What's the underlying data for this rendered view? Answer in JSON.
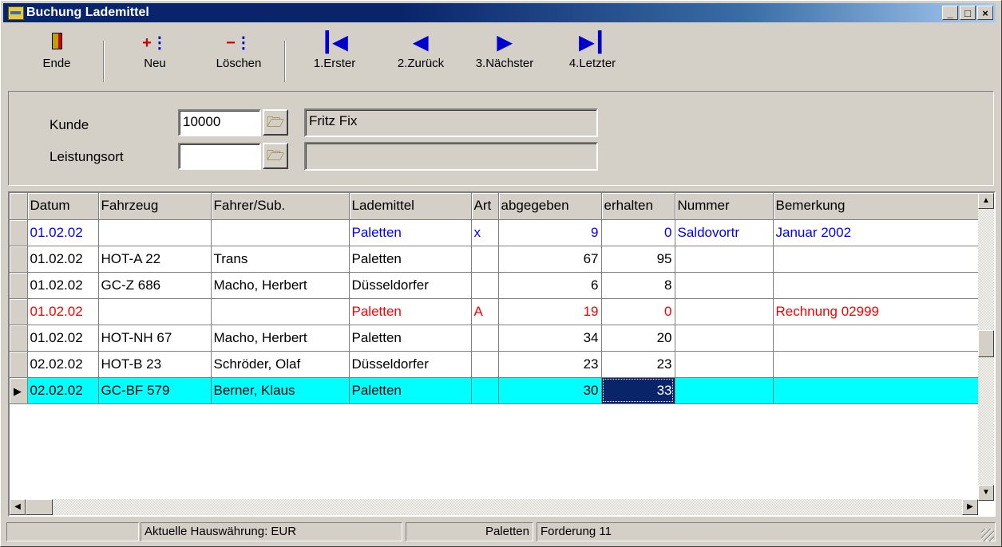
{
  "window": {
    "title": "Buchung Lademittel",
    "min_glyph": "_",
    "max_glyph": "□",
    "close_glyph": "×"
  },
  "toolbar": [
    {
      "label": "Ende",
      "icon": "door-exit-icon"
    },
    {
      "label": "Neu",
      "icon": "new-record-icon"
    },
    {
      "label": "Löschen",
      "icon": "delete-record-icon"
    },
    {
      "label": "1.Erster",
      "icon": "first-record-icon"
    },
    {
      "label": "2.Zurück",
      "icon": "previous-record-icon"
    },
    {
      "label": "3.Nächster",
      "icon": "next-record-icon"
    },
    {
      "label": "4.Letzter",
      "icon": "last-record-icon"
    }
  ],
  "form": {
    "kunde_label": "Kunde",
    "kunde_value": "10000",
    "kunde_name": "Fritz Fix",
    "leistungsort_label": "Leistungsort",
    "leistungsort_value": "",
    "leistungsort_name": ""
  },
  "grid": {
    "columns": [
      "Datum",
      "Fahrzeug",
      "Fahrer/Sub.",
      "Lademittel",
      "Art",
      "abgegeben",
      "erhalten",
      "Nummer",
      "Bemerkung"
    ],
    "rows": [
      {
        "style": "blue",
        "cells": [
          "01.02.02",
          "",
          "",
          "Paletten",
          "x",
          "9",
          "0",
          "Saldovortr",
          "Januar 2002"
        ]
      },
      {
        "style": "normal",
        "cells": [
          "01.02.02",
          "HOT-A 22",
          "Trans",
          "Paletten",
          "",
          "67",
          "95",
          "",
          ""
        ]
      },
      {
        "style": "normal",
        "cells": [
          "01.02.02",
          "GC-Z 686",
          "Macho, Herbert",
          "Düsseldorfer",
          "",
          "6",
          "8",
          "",
          ""
        ]
      },
      {
        "style": "red",
        "cells": [
          "01.02.02",
          "",
          "",
          "Paletten",
          "A",
          "19",
          "0",
          "",
          "Rechnung 02999"
        ]
      },
      {
        "style": "normal",
        "cells": [
          "01.02.02",
          "HOT-NH 67",
          "Macho, Herbert",
          "Paletten",
          "",
          "34",
          "20",
          "",
          ""
        ]
      },
      {
        "style": "normal",
        "cells": [
          "02.02.02",
          "HOT-B 23",
          "Schröder, Olaf",
          "Düsseldorfer",
          "",
          "23",
          "23",
          "",
          ""
        ]
      },
      {
        "style": "sel",
        "cells": [
          "02.02.02",
          "GC-BF 579",
          "Berner, Klaus",
          "Paletten",
          "",
          "30",
          "33",
          "",
          ""
        ]
      }
    ]
  },
  "status": {
    "currency": "Aktuelle Hauswährung: EUR",
    "lademittel": "Paletten",
    "forderung": "Forderung   11"
  },
  "colors": {
    "blue_row": "#0000ff",
    "red_row": "#ff0000",
    "selected_row": "#00ffff",
    "focus_cell": "#0a246a"
  }
}
